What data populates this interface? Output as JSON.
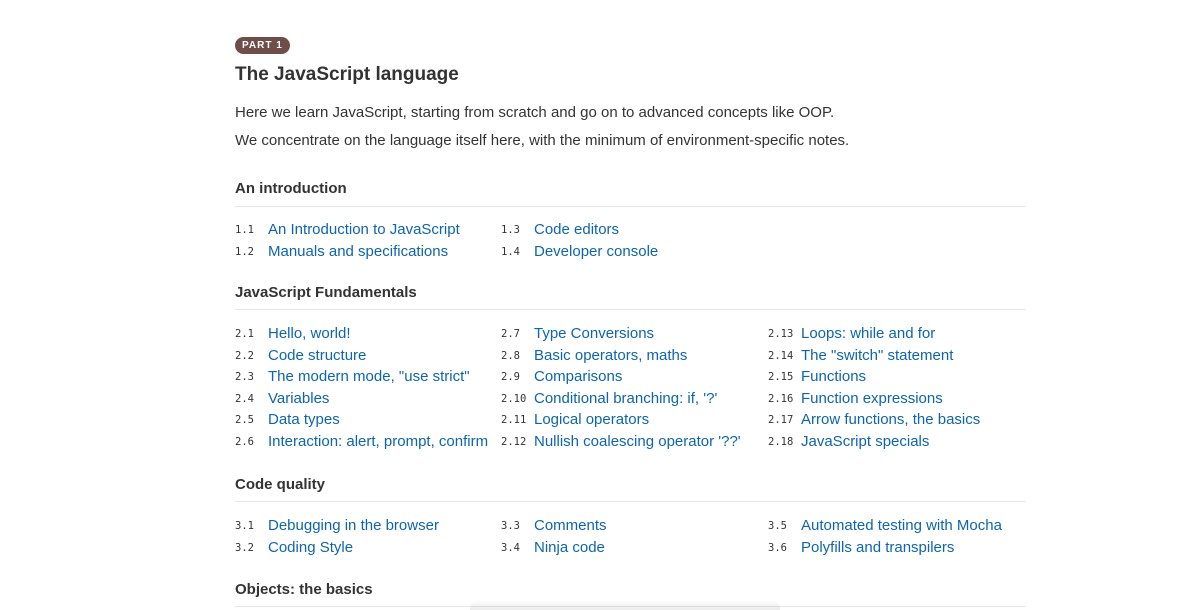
{
  "part": {
    "badge": "PART 1",
    "title": "The JavaScript language"
  },
  "intro": {
    "line1": "Here we learn JavaScript, starting from scratch and go on to advanced concepts like OOP.",
    "line2": "We concentrate on the language itself here, with the minimum of environment-specific notes."
  },
  "sections": [
    {
      "title": "An introduction",
      "columns": [
        [
          {
            "num": "1.1",
            "label": "An Introduction to JavaScript"
          },
          {
            "num": "1.2",
            "label": "Manuals and specifications"
          }
        ],
        [
          {
            "num": "1.3",
            "label": "Code editors"
          },
          {
            "num": "1.4",
            "label": "Developer console"
          }
        ]
      ]
    },
    {
      "title": "JavaScript Fundamentals",
      "columns": [
        [
          {
            "num": "2.1",
            "label": "Hello, world!"
          },
          {
            "num": "2.2",
            "label": "Code structure"
          },
          {
            "num": "2.3",
            "label": "The modern mode, \"use strict\""
          },
          {
            "num": "2.4",
            "label": "Variables"
          },
          {
            "num": "2.5",
            "label": "Data types"
          },
          {
            "num": "2.6",
            "label": "Interaction: alert, prompt, confirm"
          }
        ],
        [
          {
            "num": "2.7",
            "label": "Type Conversions"
          },
          {
            "num": "2.8",
            "label": "Basic operators, maths"
          },
          {
            "num": "2.9",
            "label": "Comparisons"
          },
          {
            "num": "2.10",
            "label": "Conditional branching: if, '?'"
          },
          {
            "num": "2.11",
            "label": "Logical operators"
          },
          {
            "num": "2.12",
            "label": "Nullish coalescing operator '??'"
          }
        ],
        [
          {
            "num": "2.13",
            "label": "Loops: while and for"
          },
          {
            "num": "2.14",
            "label": "The \"switch\" statement"
          },
          {
            "num": "2.15",
            "label": "Functions"
          },
          {
            "num": "2.16",
            "label": "Function expressions"
          },
          {
            "num": "2.17",
            "label": "Arrow functions, the basics"
          },
          {
            "num": "2.18",
            "label": "JavaScript specials"
          }
        ]
      ]
    },
    {
      "title": "Code quality",
      "columns": [
        [
          {
            "num": "3.1",
            "label": "Debugging in the browser"
          },
          {
            "num": "3.2",
            "label": "Coding Style"
          }
        ],
        [
          {
            "num": "3.3",
            "label": "Comments"
          },
          {
            "num": "3.4",
            "label": "Ninja code"
          }
        ],
        [
          {
            "num": "3.5",
            "label": "Automated testing with Mocha"
          },
          {
            "num": "3.6",
            "label": "Polyfills and transpilers"
          }
        ]
      ]
    },
    {
      "title": "Objects: the basics",
      "columns": []
    }
  ],
  "colors": {
    "link": "#0b65b0",
    "badge_bg": "#6f4e4a",
    "text": "#333333"
  }
}
